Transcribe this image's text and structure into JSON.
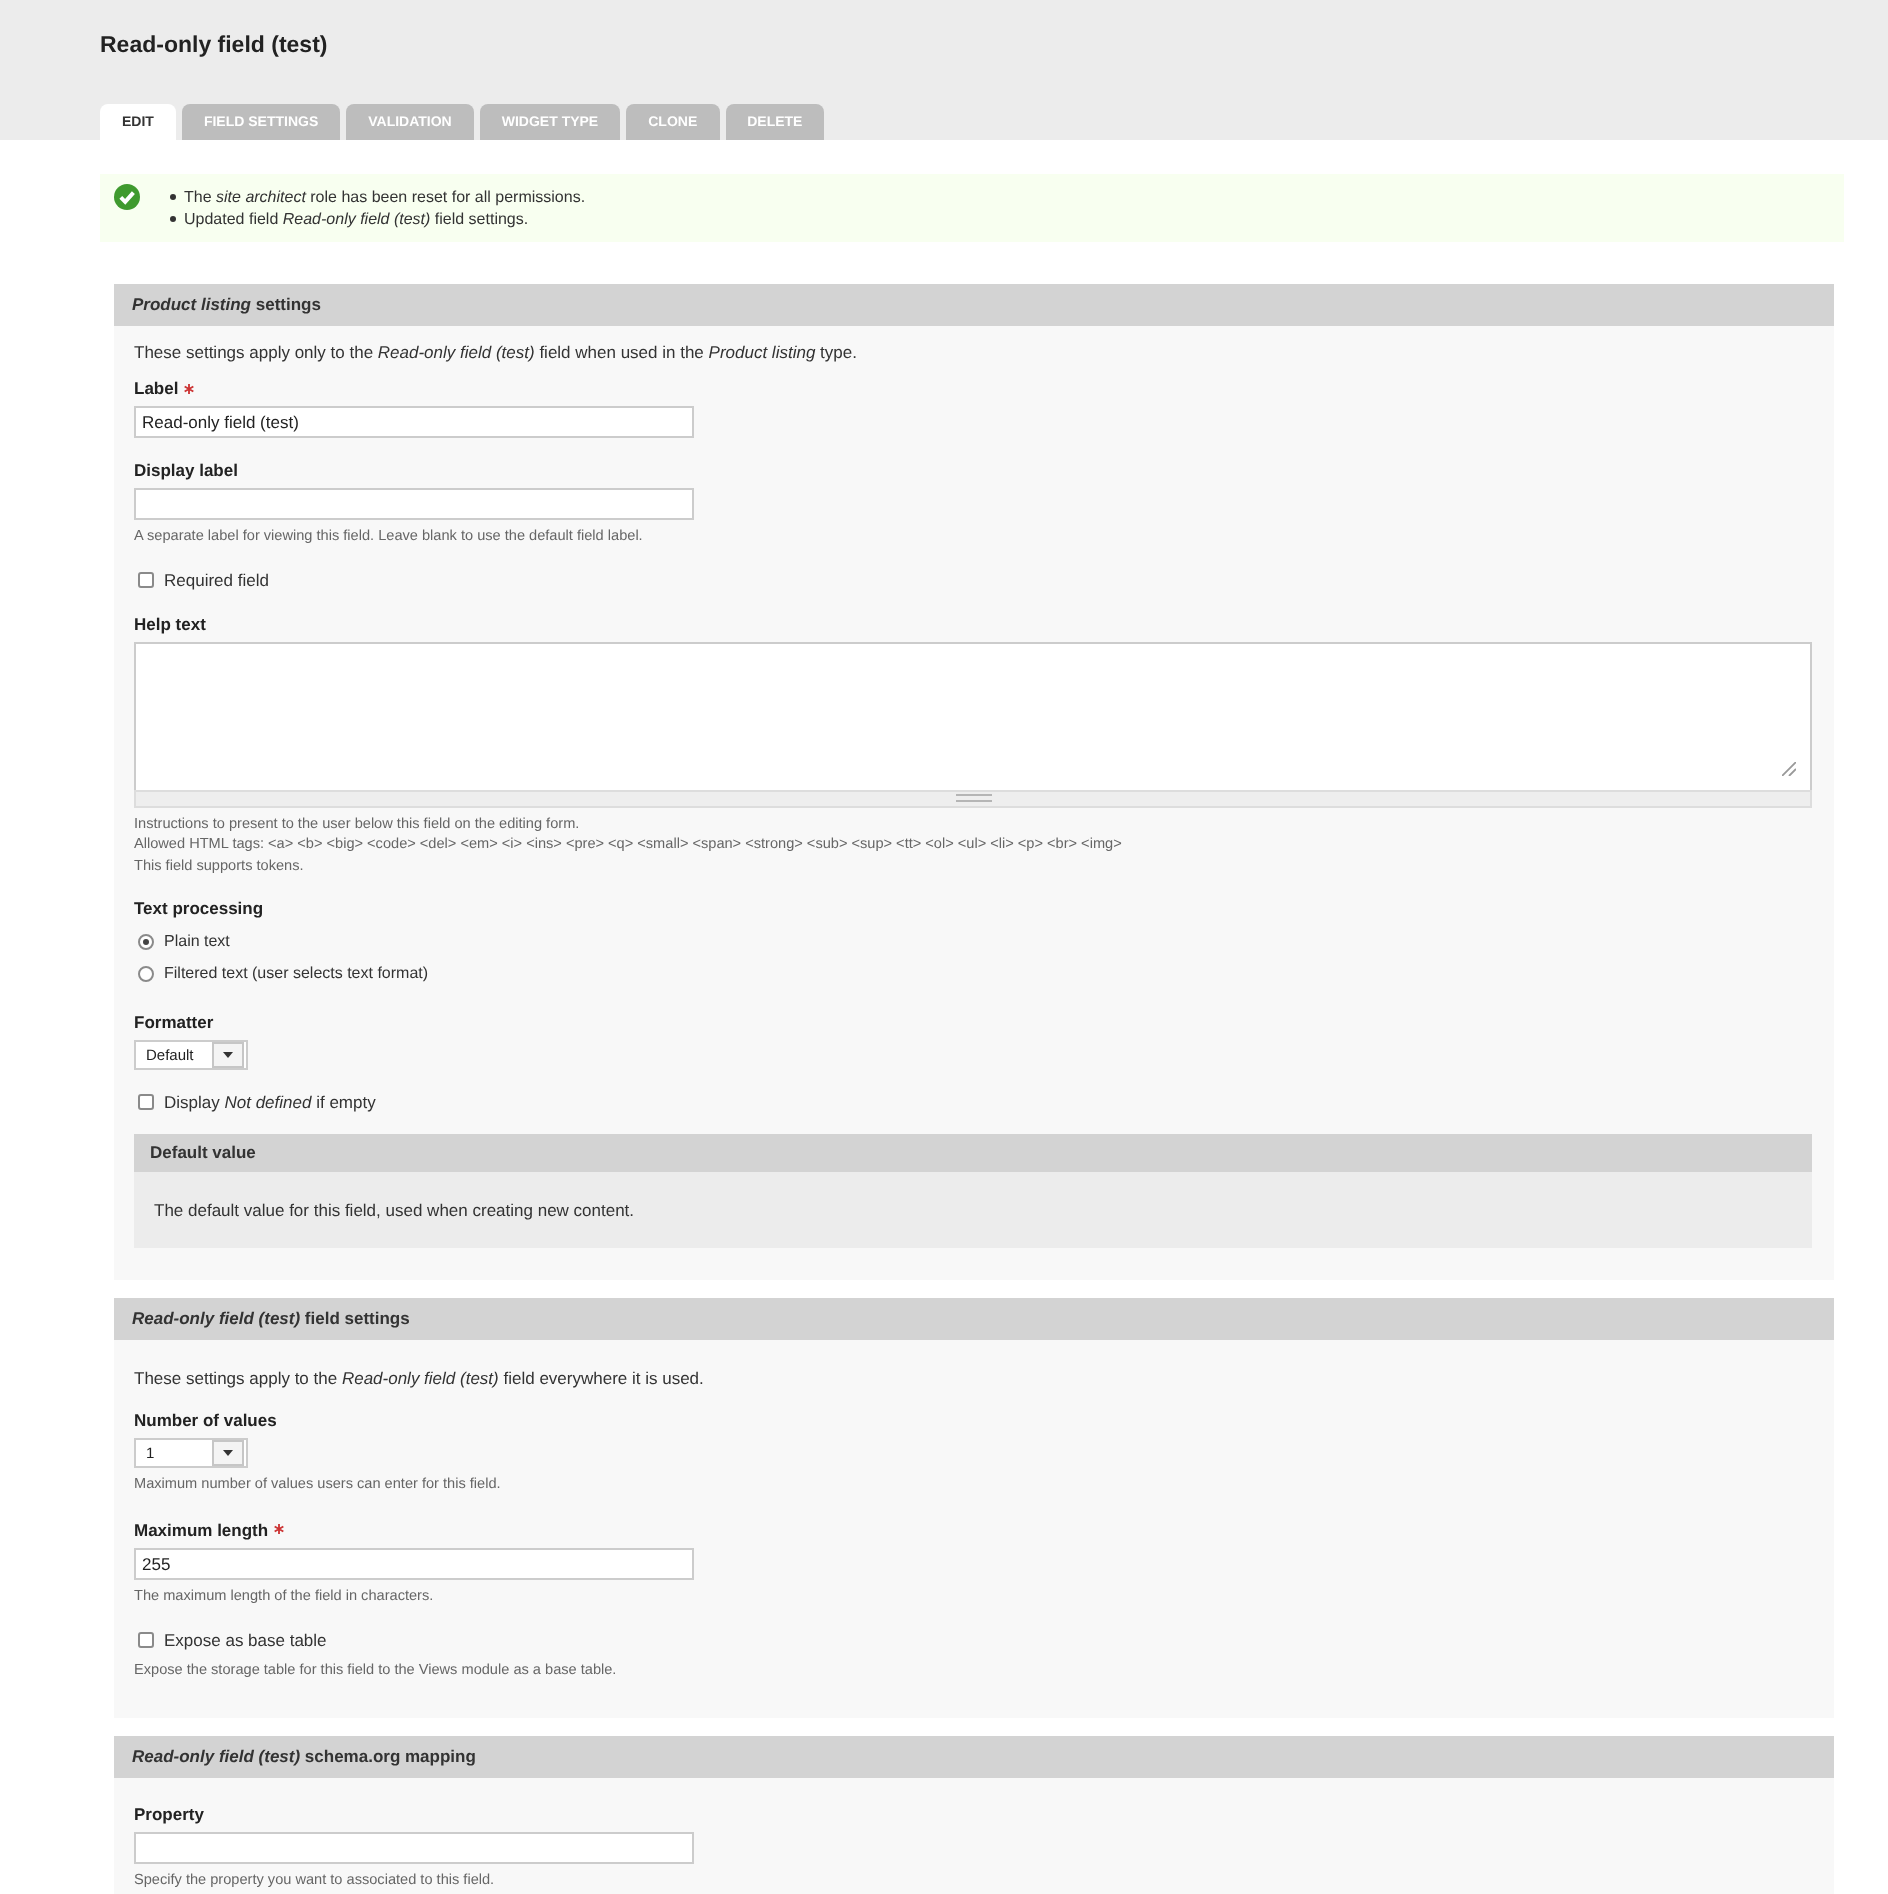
{
  "page": {
    "title": "Read-only field (test)"
  },
  "tabs": [
    {
      "label": "EDIT",
      "selected": true
    },
    {
      "label": "FIELD SETTINGS",
      "selected": false
    },
    {
      "label": "VALIDATION",
      "selected": false
    },
    {
      "label": "WIDGET TYPE",
      "selected": false
    },
    {
      "label": "CLONE",
      "selected": false
    },
    {
      "label": "DELETE",
      "selected": false
    }
  ],
  "message": {
    "kind": "status",
    "items": [
      "The *site architect* role has been reset for all permissions.",
      "Updated field *Read-only field (test)* field settings."
    ]
  },
  "sections": [
    {
      "title": "*Product listing* settings",
      "description": "These settings apply only to the *Read-only field (test)* field when used in the *Product listing* type.",
      "items": [
        {
          "kind": "textfield",
          "label": "Label",
          "required": true,
          "value": "Read-only field (test)"
        },
        {
          "kind": "textfield",
          "label": "Display label",
          "required": false,
          "description": [
            "A separate label for viewing this field. Leave blank to use the default field label."
          ]
        },
        {
          "kind": "checkbox",
          "label": "Required field",
          "checked": false
        },
        {
          "kind": "textarea",
          "label": "Help text",
          "required": false,
          "description": [
            "Instructions to present to the user below this field on the editing form.",
            "Allowed HTML tags: <a> <b> <big> <code> <del> <em> <i> <ins> <pre> <q> <small> <span> <strong> <sub> <sup> <tt> <ol> <ul> <li> <p> <br> <img>",
            "This field supports tokens."
          ]
        },
        {
          "kind": "radios",
          "label": "Text processing",
          "required": false,
          "options": [
            {
              "label": "Plain text",
              "selected": true
            },
            {
              "label": "Filtered text (user selects text format)",
              "selected": false
            }
          ]
        },
        {
          "kind": "select",
          "label": "Formatter",
          "required": false,
          "value": "Default"
        },
        {
          "kind": "checkbox",
          "label": "Display *Not defined* if empty",
          "checked": false
        },
        {
          "kind": "fieldset",
          "title": "Default value",
          "text": "The default value for this field, used when creating new content."
        }
      ]
    },
    {
      "title": "*Read-only field (test)* field settings",
      "description": "These settings apply to the *Read-only field (test)* field everywhere it is used.",
      "items": [
        {
          "kind": "select",
          "label": "Number of values",
          "required": false,
          "value": "1",
          "description": [
            "Maximum number of values users can enter for this field."
          ]
        },
        {
          "kind": "textfield",
          "label": "Maximum length",
          "required": true,
          "value": "255",
          "description": [
            "The maximum length of the field in characters."
          ]
        },
        {
          "kind": "checkbox",
          "label": "Expose as base table",
          "checked": false,
          "description": [
            "Expose the storage table for this field to the Views module as a base table."
          ]
        }
      ]
    },
    {
      "title": "*Read-only field (test)* schema.org mapping",
      "items": [
        {
          "kind": "textfield",
          "label": "Property",
          "required": false,
          "description": [
            "Specify the property you want to associated to this field."
          ]
        }
      ]
    }
  ]
}
